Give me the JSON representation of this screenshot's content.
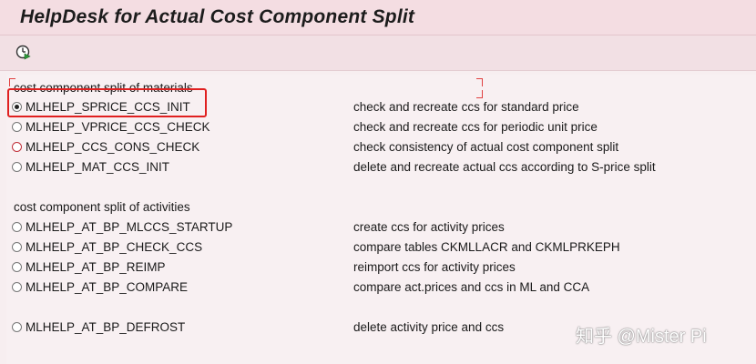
{
  "window": {
    "title": "HelpDesk for Actual Cost Component Split"
  },
  "toolbar": {
    "execute_icon": "execute-clock-icon"
  },
  "sections": [
    {
      "title": "cost component split of materials"
    },
    {
      "title": "cost component split of activities"
    }
  ],
  "options": [
    {
      "program": "MLHELP_SPRICE_CCS_INIT",
      "description": "check and recreate ccs for standard price",
      "selected": true
    },
    {
      "program": "MLHELP_VPRICE_CCS_CHECK",
      "description": "check and recreate ccs for periodic unit price",
      "selected": false
    },
    {
      "program": "MLHELP_CCS_CONS_CHECK",
      "description": "check consistency of actual cost component split",
      "selected": false
    },
    {
      "program": "MLHELP_MAT_CCS_INIT",
      "description": "delete and recreate actual ccs according to S-price split",
      "selected": false
    },
    {
      "program": "MLHELP_AT_BP_MLCCS_STARTUP",
      "description": "create ccs for activity prices",
      "selected": false
    },
    {
      "program": "MLHELP_AT_BP_CHECK_CCS",
      "description": "compare tables CKMLLACR and CKMLPRKEPH",
      "selected": false
    },
    {
      "program": "MLHELP_AT_BP_REIMP",
      "description": "reimport ccs for activity prices",
      "selected": false
    },
    {
      "program": "MLHELP_AT_BP_COMPARE",
      "description": "compare act.prices and ccs in ML and CCA",
      "selected": false
    },
    {
      "program": "MLHELP_AT_BP_DEFROST",
      "description": "delete activity price and ccs",
      "selected": false
    }
  ],
  "watermark": "知乎 @Mister Pi",
  "colors": {
    "highlight": "#e02020",
    "title_bar": "#f4dde2",
    "background": "#f8f0f2"
  }
}
